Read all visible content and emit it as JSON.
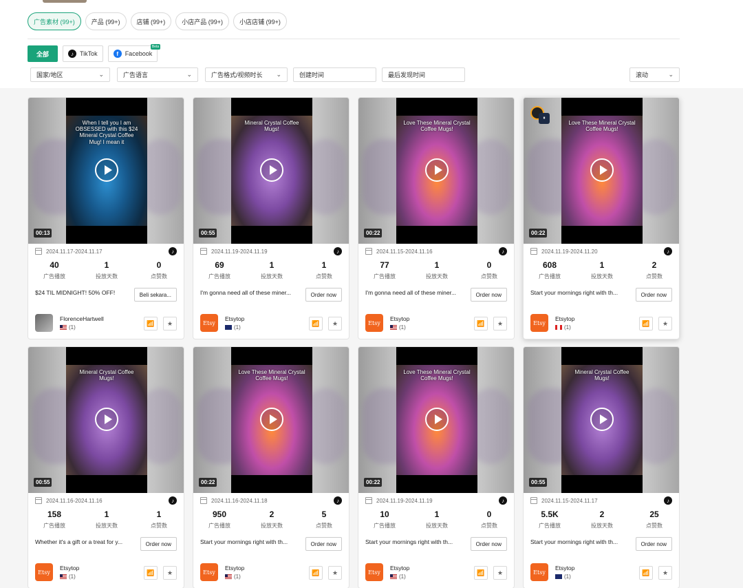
{
  "tabs": [
    "广告素材 (99+)",
    "产品 (99+)",
    "店铺 (99+)",
    "小店产品 (99+)",
    "小店店铺 (99+)"
  ],
  "platforms": {
    "all": "全部",
    "tiktok": "TikTok",
    "facebook": "Facebook",
    "beta": "Beta"
  },
  "filters": {
    "region": "国家/地区",
    "language": "广告语言",
    "format": "广告格式/视频时长",
    "created": "创建时间",
    "last_seen": "最后发现时间",
    "sort": "滚动"
  },
  "labels": {
    "plays": "广告播放",
    "days": "投放天数",
    "likes": "点赞数"
  },
  "cards": [
    {
      "duration": "00:13",
      "dates": "2024.11.17-2024.11.17",
      "plays": "40",
      "days": "1",
      "likes": "0",
      "desc": "$24 TIL MIDNIGHT! 50% OFF!",
      "cta": "Beli sekara...",
      "advertiser": "FlorenceHartwell",
      "country": "(1)",
      "flag": "us",
      "caption": "When I tell you I am OBSESSED with this $24 Mineral Crystal Coffee Mug! I mean it"
    },
    {
      "duration": "00:55",
      "dates": "2024.11.19-2024.11.19",
      "plays": "69",
      "days": "1",
      "likes": "1",
      "desc": "I'm gonna need all of these miner...",
      "cta": "Order now",
      "advertiser": "Etsytop",
      "country": "(1)",
      "flag": "au",
      "caption": "Mineral Crystal Coffee Mugs!"
    },
    {
      "duration": "00:22",
      "dates": "2024.11.15-2024.11.16",
      "plays": "77",
      "days": "1",
      "likes": "0",
      "desc": "I'm gonna need all of these miner...",
      "cta": "Order now",
      "advertiser": "Etsytop",
      "country": "(1)",
      "flag": "us",
      "caption": "Love These Mineral Crystal Coffee Mugs!"
    },
    {
      "duration": "00:22",
      "dates": "2024.11.19-2024.11.20",
      "plays": "608",
      "days": "1",
      "likes": "2",
      "desc": "Start your mornings right with th...",
      "cta": "Order now",
      "advertiser": "Etsytop",
      "country": "(1)",
      "flag": "ca",
      "caption": "Love These Mineral Crystal Coffee Mugs!"
    },
    {
      "duration": "00:55",
      "dates": "2024.11.16-2024.11.16",
      "plays": "158",
      "days": "1",
      "likes": "1",
      "desc": "Whether it's a gift or a treat for y...",
      "cta": "Order now",
      "advertiser": "Etsytop",
      "country": "(1)",
      "flag": "us",
      "caption": "Mineral Crystal Coffee Mugs!"
    },
    {
      "duration": "00:22",
      "dates": "2024.11.16-2024.11.18",
      "plays": "950",
      "days": "2",
      "likes": "5",
      "desc": "Start your mornings right with th...",
      "cta": "Order now",
      "advertiser": "Etsytop",
      "country": "(1)",
      "flag": "us",
      "caption": "Love These Mineral Crystal Coffee Mugs!"
    },
    {
      "duration": "00:22",
      "dates": "2024.11.19-2024.11.19",
      "plays": "10",
      "days": "1",
      "likes": "0",
      "desc": "Start your mornings right with th...",
      "cta": "Order now",
      "advertiser": "Etsytop",
      "country": "(1)",
      "flag": "us",
      "caption": "Love These Mineral Crystal Coffee Mugs!"
    },
    {
      "duration": "00:55",
      "dates": "2024.11.15-2024.11.17",
      "plays": "5.5K",
      "days": "2",
      "likes": "25",
      "desc": "Start your mornings right with th...",
      "cta": "Order now",
      "advertiser": "Etsytop",
      "country": "(1)",
      "flag": "au",
      "caption": "Mineral Crystal Coffee Mugs!"
    }
  ],
  "brand_logo_text": "Etsy",
  "colors": {
    "accent": "#1aa37a",
    "etsy": "#f1641e"
  }
}
